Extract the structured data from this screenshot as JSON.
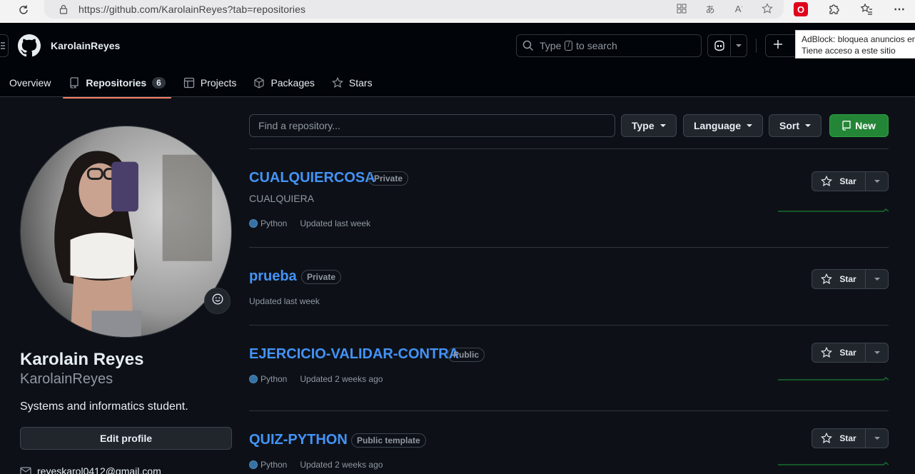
{
  "browser": {
    "url": "https://github.com/KarolainReyes?tab=repositories",
    "adblock_tooltip_line1": "AdBlock: bloquea anuncios en",
    "adblock_tooltip_line2": "Tiene acceso a este sitio"
  },
  "header": {
    "username": "KarolainReyes",
    "search_prefix": "Type",
    "search_key": "/",
    "search_suffix": "to search"
  },
  "tabs": [
    {
      "label": "Overview",
      "icon": "book-open-icon"
    },
    {
      "label": "Repositories",
      "icon": "repo-icon",
      "count": "6",
      "active": true
    },
    {
      "label": "Projects",
      "icon": "table-icon"
    },
    {
      "label": "Packages",
      "icon": "package-icon"
    },
    {
      "label": "Stars",
      "icon": "star-icon"
    }
  ],
  "profile": {
    "full_name": "Karolain Reyes",
    "login": "KarolainReyes",
    "bio": "Systems and informatics student.",
    "edit_label": "Edit profile",
    "email": "reyeskarol0412@gmail.com"
  },
  "filters": {
    "search_placeholder": "Find a repository...",
    "type_label": "Type",
    "language_label": "Language",
    "sort_label": "Sort",
    "new_label": "New"
  },
  "repos": [
    {
      "name": "CUALQUIERCOSA",
      "visibility": "Private",
      "description": "CUALQUIERA",
      "language": "Python",
      "updated": "Updated last week",
      "star_label": "Star"
    },
    {
      "name": "prueba",
      "visibility": "Private",
      "description": "",
      "language": "",
      "updated": "Updated last week",
      "star_label": "Star"
    },
    {
      "name": "EJERCICIO-VALIDAR-CONTRA",
      "visibility": "Public",
      "description": "",
      "language": "Python",
      "updated": "Updated 2 weeks ago",
      "star_label": "Star"
    },
    {
      "name": "QUIZ-PYTHON",
      "visibility": "Public template",
      "description": "",
      "language": "Python",
      "updated": "Updated 2 weeks ago",
      "star_label": "Star"
    }
  ],
  "colors": {
    "accent_link": "#4493f8",
    "new_button": "#238636",
    "tab_underline": "#f78166",
    "python": "#3572a5"
  }
}
